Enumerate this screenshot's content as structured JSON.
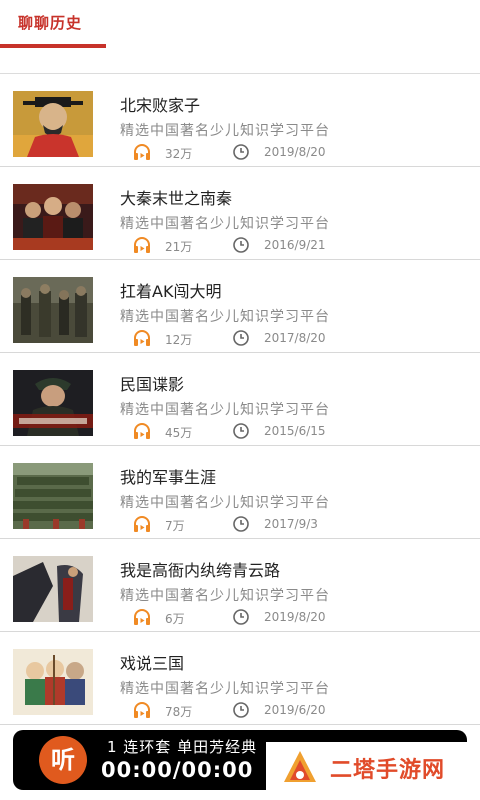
{
  "tabs": [
    {
      "label": "聊聊历史",
      "active": true
    }
  ],
  "accent_color": "#c7322a",
  "items": [
    {
      "title": "北宋败家子",
      "desc": "精选中国著名少儿知识学习平台",
      "plays": "32万",
      "date": "2019/8/20",
      "thumb_icon": "emperor-portrait-thumbnail"
    },
    {
      "title": "大秦末世之南秦",
      "desc": "精选中国著名少儿知识学习平台",
      "plays": "21万",
      "date": "2016/9/21",
      "thumb_icon": "drama-poster-thumbnail"
    },
    {
      "title": "扛着AK闯大明",
      "desc": "精选中国著名少儿知识学习平台",
      "plays": "12万",
      "date": "2017/8/20",
      "thumb_icon": "soldiers-scene-thumbnail"
    },
    {
      "title": "民国谍影",
      "desc": "精选中国著名少儿知识学习平台",
      "plays": "45万",
      "date": "2015/6/15",
      "thumb_icon": "spy-drama-poster-thumbnail"
    },
    {
      "title": "我的军事生涯",
      "desc": "精选中国著名少儿知识学习平台",
      "plays": "7万",
      "date": "2017/9/3",
      "thumb_icon": "army-parade-thumbnail"
    },
    {
      "title": "我是高衙内纨绔青云路",
      "desc": "精选中国著名少儿知识学习平台",
      "plays": "6万",
      "date": "2019/8/20",
      "thumb_icon": "novel-cover-thumbnail"
    },
    {
      "title": "戏说三国",
      "desc": "精选中国著名少儿知识学习平台",
      "plays": "78万",
      "date": "2019/6/20",
      "thumb_icon": "cartoon-warriors-thumbnail"
    }
  ],
  "player": {
    "logo_text": "听",
    "track": "1 连环套  单田芳经典",
    "time": "00:00/00:00"
  },
  "watermark": {
    "text": "二塔手游网"
  }
}
